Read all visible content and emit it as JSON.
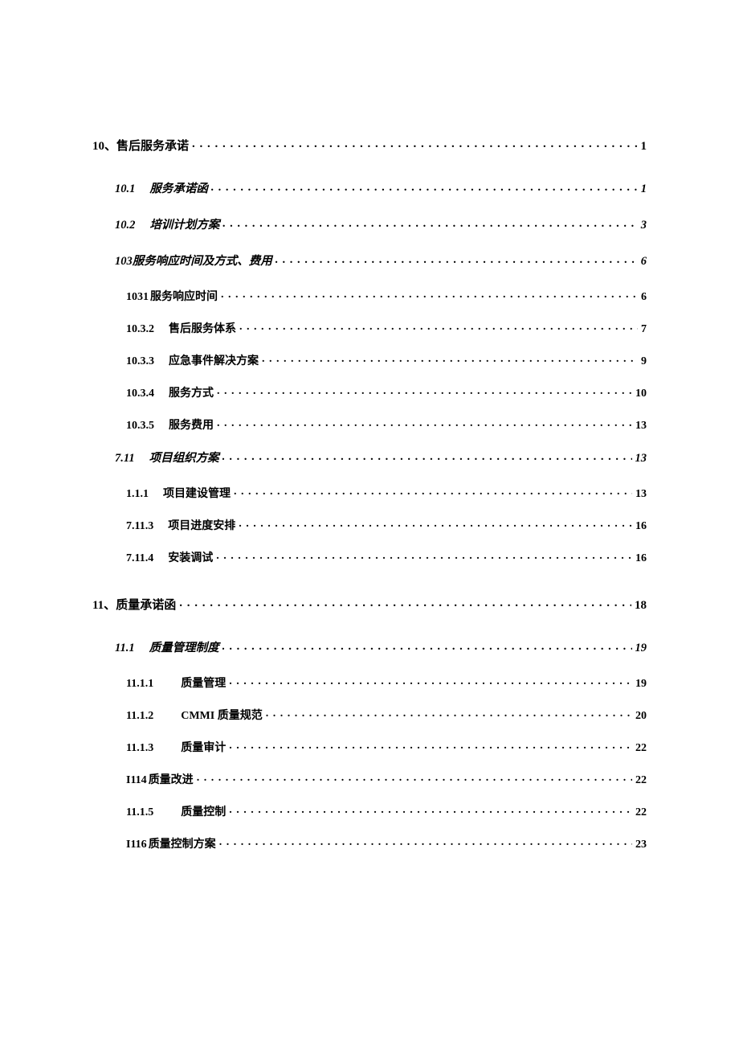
{
  "entries": [
    {
      "level": 1,
      "num": "10、",
      "title": "售后服务承诺",
      "page": "1",
      "gapTop": false
    },
    {
      "level": 2,
      "num": "10.1",
      "title": "服务承诺函",
      "page": "1"
    },
    {
      "level": 2,
      "num": "10.2",
      "title": "培训计划方案",
      "page": "3"
    },
    {
      "level": 2,
      "num": "103",
      "title": "服务响应时间及方式、费用",
      "page": "6",
      "noNumGap": true
    },
    {
      "level": 3,
      "num": "1031",
      "title": "服务响应时间",
      "page": "6",
      "noNumGap": true
    },
    {
      "level": 3,
      "num": "10.3.2",
      "title": "售后服务体系",
      "page": "7"
    },
    {
      "level": 3,
      "num": "10.3.3",
      "title": "应急事件解决方案",
      "page": "9"
    },
    {
      "level": 3,
      "num": "10.3.4",
      "title": "服务方式",
      "page": "10"
    },
    {
      "level": 3,
      "num": "10.3.5",
      "title": "服务费用",
      "page": "13"
    },
    {
      "level": 2,
      "num": "7.11",
      "title": "项目组织方案",
      "page": "13"
    },
    {
      "level": 3,
      "num": "1.1.1",
      "title": "项目建设管理",
      "page": "13"
    },
    {
      "level": 3,
      "num": "7.11.3",
      "title": "项目进度安排",
      "page": "16"
    },
    {
      "level": 3,
      "num": "7.11.4",
      "title": "安装调试",
      "page": "16"
    },
    {
      "level": 1,
      "num": "11、",
      "title": "质量承诺函",
      "page": "18",
      "gapTop": true
    },
    {
      "level": 2,
      "num": "11.1",
      "title": "质量管理制度",
      "page": "19"
    },
    {
      "level": 3,
      "num": "11.1.1",
      "title": "质量管理",
      "page": "19",
      "wideGap": true
    },
    {
      "level": 3,
      "num": "11.1.2",
      "title": "CMMI 质量规范",
      "page": "20",
      "wideGap": true
    },
    {
      "level": 3,
      "num": "11.1.3",
      "title": "质量审计",
      "page": "22",
      "wideGap": true
    },
    {
      "level": 3,
      "num": "I114",
      "title": "质量改进",
      "page": "22",
      "noNumGap": true
    },
    {
      "level": 3,
      "num": "11.1.5",
      "title": "质量控制",
      "page": "22",
      "wideGap": true
    },
    {
      "level": 3,
      "num": "I116",
      "title": "质量控制方案",
      "page": "23",
      "noNumGap": true
    }
  ]
}
